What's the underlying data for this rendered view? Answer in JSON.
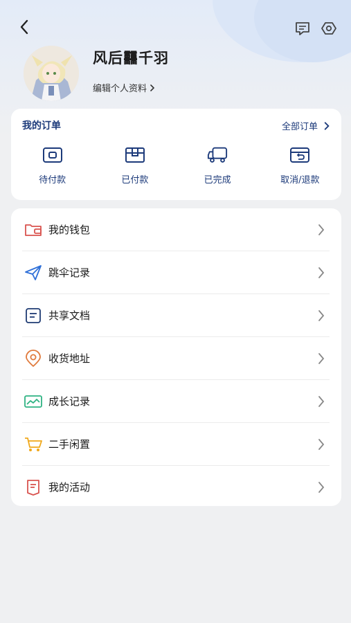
{
  "header": {
    "back_icon": "chevron-left-icon",
    "chat_icon": "message-icon",
    "settings_icon": "settings-icon"
  },
  "profile": {
    "username": "风后䨻千羽",
    "edit_label": "编辑个人资料",
    "edit_chevron": "›"
  },
  "orders": {
    "title": "我的订单",
    "all_label": "全部订单",
    "items": [
      {
        "label": "待付款",
        "icon": "wallet-icon"
      },
      {
        "label": "已付款",
        "icon": "package-icon"
      },
      {
        "label": "已完成",
        "icon": "truck-icon"
      },
      {
        "label": "取消/退款",
        "icon": "refund-icon"
      }
    ]
  },
  "menu": {
    "items": [
      {
        "label": "我的钱包",
        "icon": "wallet-icon",
        "color": "#d9534f"
      },
      {
        "label": "跳伞记录",
        "icon": "send-icon",
        "color": "#2e6fd8"
      },
      {
        "label": "共享文档",
        "icon": "document-icon",
        "color": "#1f3b73"
      },
      {
        "label": "收货地址",
        "icon": "location-icon",
        "color": "#e07a3c"
      },
      {
        "label": "成长记录",
        "icon": "chart-icon",
        "color": "#2fb383"
      },
      {
        "label": "二手闲置",
        "icon": "cart-icon",
        "color": "#f0a81a"
      },
      {
        "label": "我的活动",
        "icon": "bookmark-icon",
        "color": "#d9534f"
      }
    ]
  },
  "colors": {
    "accent": "#1c3a7a",
    "background": "#eff0f2",
    "card": "#ffffff"
  }
}
